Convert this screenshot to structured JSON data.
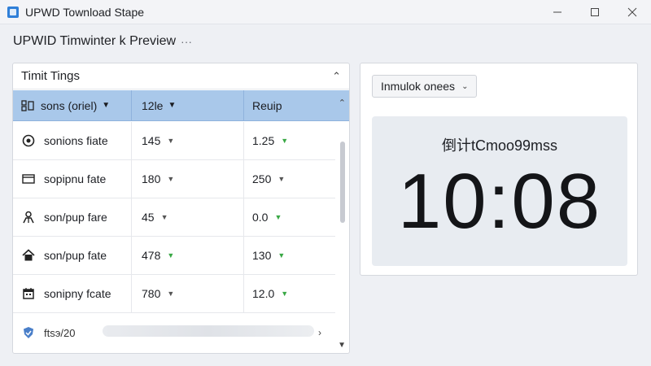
{
  "window": {
    "title": "UPWD Townload Stape",
    "controls": [
      "minimize",
      "maximize",
      "close"
    ]
  },
  "subtitle": {
    "text": "UPWID Timwinter k Preview",
    "more": "···"
  },
  "left_panel": {
    "title": "Timit Tings",
    "columns": [
      {
        "label": "sons (oriel)",
        "icon": "list-icon"
      },
      {
        "label": "12le"
      },
      {
        "label": "Reuip"
      }
    ],
    "rows": [
      {
        "name": "sonions fiate",
        "icon": "power-icon",
        "value": "145",
        "value_trend": "none",
        "result": "1.25",
        "result_trend": "down-green"
      },
      {
        "name": "sopipnu fate",
        "icon": "card-icon",
        "value": "180",
        "value_trend": "none",
        "result": "250",
        "result_trend": "down-gray"
      },
      {
        "name": "son/pup fare",
        "icon": "person-icon",
        "value": "45",
        "value_trend": "none",
        "result": "0.0",
        "result_trend": "down-green"
      },
      {
        "name": "son/pup fate",
        "icon": "home-icon",
        "value": "478",
        "value_trend": "down-green",
        "result": "130",
        "result_trend": "down-green"
      },
      {
        "name": "sonipny fcate",
        "icon": "calendar-icon",
        "value": "780",
        "value_trend": "none",
        "result": "12.0",
        "result_trend": "down-green"
      }
    ],
    "last_row": {
      "name": "ftsэ/20",
      "icon": "shield-icon"
    }
  },
  "right_panel": {
    "dropdown": "Inmulok onees",
    "timer_label": "倒计tCmoo99mss",
    "timer_value": "10:08"
  },
  "colors": {
    "header_row": "#a9c8ea",
    "accent": "#2f7fd8",
    "trend_green": "#39a845"
  }
}
